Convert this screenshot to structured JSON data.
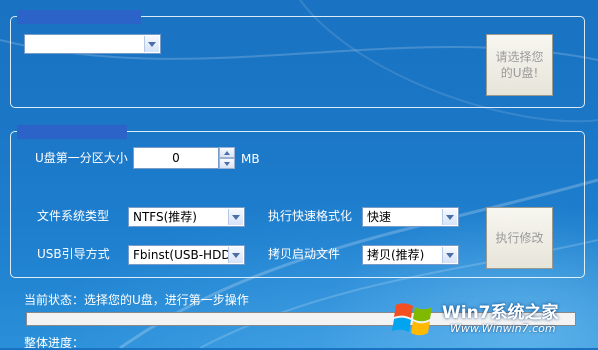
{
  "group1": {
    "title": "",
    "drive_select": {
      "value": ""
    },
    "select_prompt_button": "请选择您的U盘!"
  },
  "group2": {
    "title": "",
    "partition_label": "U盘第一分区大小",
    "partition_value": "0",
    "partition_unit": "MB",
    "fs_label": "文件系统类型",
    "fs_value": "NTFS(推荐)",
    "quick_format_label": "执行快速格式化",
    "quick_format_value": "快速",
    "usb_boot_label": "USB引导方式",
    "usb_boot_value": "Fbinst(USB-HDD)",
    "copy_boot_label": "拷贝启动文件",
    "copy_boot_value": "拷贝(推荐)",
    "execute_button": "执行修改"
  },
  "status": {
    "current_status": "当前状态：选择您的U盘，进行第一步操作",
    "overall_progress_label": "整体进度：",
    "progress": 0
  },
  "watermark": {
    "title": "Win7系统之家",
    "url": "Www.Winwin7.com"
  }
}
